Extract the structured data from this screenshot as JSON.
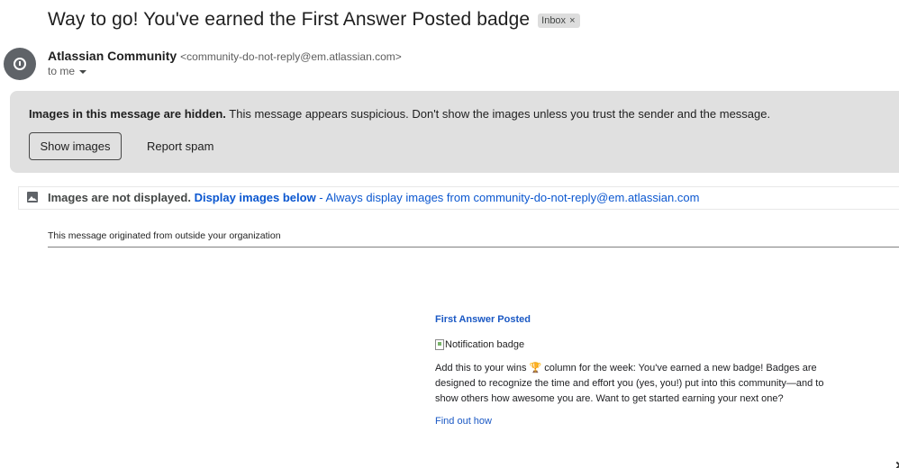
{
  "subject": "Way to go! You've earned the First Answer Posted badge",
  "label": {
    "name": "Inbox",
    "remove_glyph": "×"
  },
  "sender": {
    "name": "Atlassian Community",
    "email": "<community-do-not-reply@em.atlassian.com>",
    "to": "to me",
    "avatar_icon": "warning-circle-icon"
  },
  "warning": {
    "bold": "Images in this message are hidden.",
    "text": " This message appears suspicious. Don't show the images unless you trust the sender and the message.",
    "show_images": "Show images",
    "report_spam": "Report spam"
  },
  "images_bar": {
    "icon": "image-icon",
    "bold": "Images are not displayed.",
    "display_link": "Display images below",
    "separator": " - ",
    "always_link": "Always display images from community-do-not-reply@em.atlassian.com"
  },
  "external_notice": "This message originated from outside your organization",
  "email_body": {
    "title": "First Answer Posted",
    "image_alt": "Notification badge",
    "paragraph": "Add this to your wins 🏆 column for the week: You've earned a new badge! Badges are designed to recognize the time and effort you (yes, you!) put into this community—and to show others how awesome you are. Want to get started earning your next one?",
    "link": "Find out how"
  },
  "colors": {
    "link": "#0b57d0",
    "body_link": "#1a58c4",
    "banner_bg": "#e0e0e0",
    "avatar_bg": "#5f6368"
  }
}
